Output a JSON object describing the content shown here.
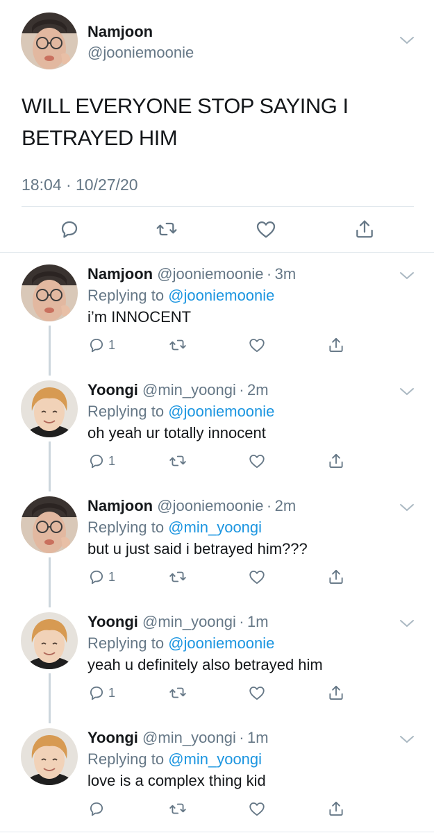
{
  "main_tweet": {
    "name": "Namjoon",
    "handle": "@jooniemoonie",
    "text": "WILL EVERYONE STOP SAYING I BETRAYED HIM",
    "timestamp": "18:04 · 10/27/20",
    "avatar": "namjoon-avatar"
  },
  "replies": [
    {
      "name": "Namjoon",
      "handle": "@jooniemoonie",
      "sep": "·",
      "time": "3m",
      "replying_prefix": "Replying to ",
      "replying_to": "@jooniemoonie",
      "text": "i’m INNOCENT",
      "reply_count": "1",
      "avatar": "namjoon-avatar"
    },
    {
      "name": "Yoongi",
      "handle": "@min_yoongi",
      "sep": "·",
      "time": "2m",
      "replying_prefix": "Replying to ",
      "replying_to": "@jooniemoonie",
      "text": "oh yeah ur totally innocent",
      "reply_count": "1",
      "avatar": "yoongi-avatar"
    },
    {
      "name": "Namjoon",
      "handle": "@jooniemoonie",
      "sep": "·",
      "time": "2m",
      "replying_prefix": "Replying to ",
      "replying_to": "@min_yoongi",
      "text": "but u just said i betrayed him???",
      "reply_count": "1",
      "avatar": "namjoon-avatar"
    },
    {
      "name": "Yoongi",
      "handle": "@min_yoongi",
      "sep": "·",
      "time": "1m",
      "replying_prefix": "Replying to ",
      "replying_to": "@jooniemoonie",
      "text": "yeah u definitely also betrayed him",
      "reply_count": "1",
      "avatar": "yoongi-avatar"
    },
    {
      "name": "Yoongi",
      "handle": "@min_yoongi",
      "sep": "·",
      "time": "1m",
      "replying_prefix": "Replying to ",
      "replying_to": "@min_yoongi",
      "text": "love is a complex thing kid",
      "reply_count": "",
      "avatar": "yoongi-avatar"
    }
  ],
  "icons": {
    "reply": "reply-icon",
    "retweet": "retweet-icon",
    "like": "heart-icon",
    "share": "share-icon",
    "menu": "chevron-down-icon"
  },
  "colors": {
    "text": "#14171a",
    "secondary": "#657786",
    "link": "#1b95e0",
    "divider": "#e1e8ed",
    "thread_line": "#ccd6dd"
  }
}
